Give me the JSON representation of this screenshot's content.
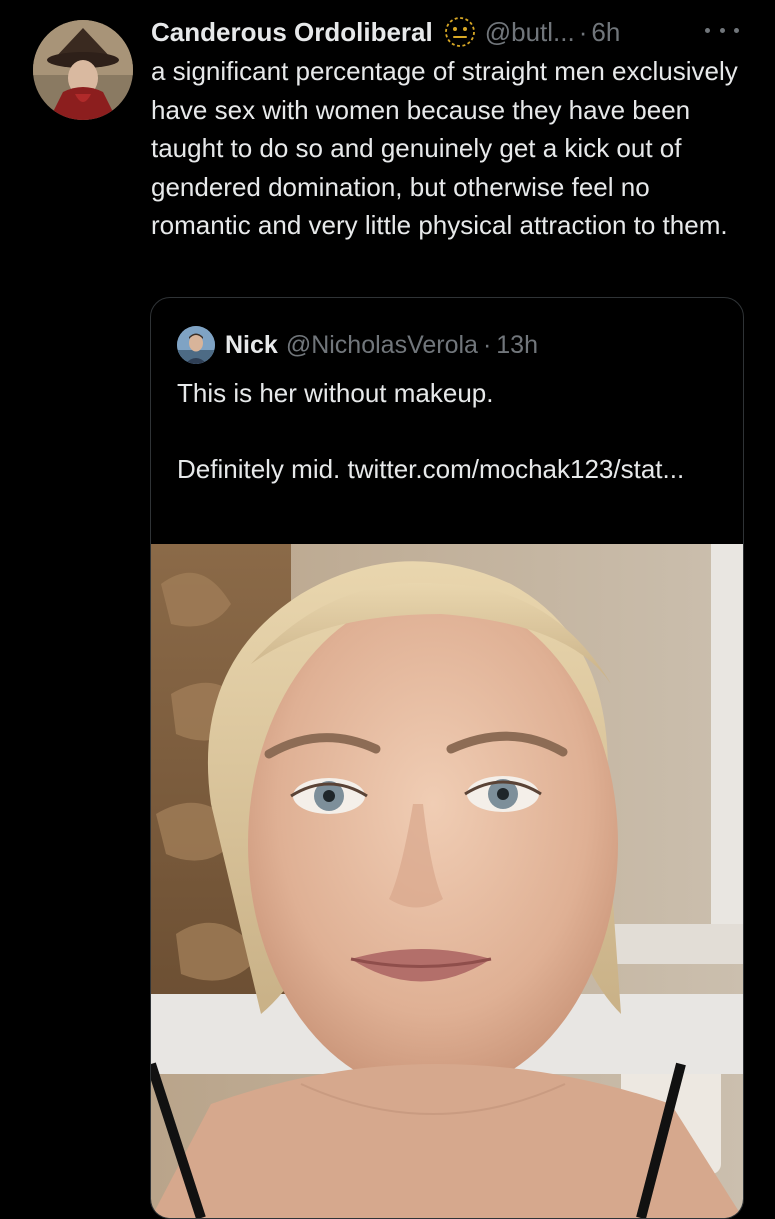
{
  "tweet": {
    "display_name": "Canderous Ordoliberal",
    "badge_icon": "neutral-face-emoji-icon",
    "handle": "@butl...",
    "separator": "·",
    "time": "6h",
    "more_icon": "more-horizontal-icon",
    "text": "a significant percentage of straight men exclusively have sex with women because they have been taught to do so and genuinely get a kick out of gendered domination, but otherwise feel no romantic and very little physical attraction to them."
  },
  "quote": {
    "display_name": "Nick",
    "handle": "@NicholasVerola",
    "separator": "·",
    "time": "13h",
    "text_line1": "This is her without makeup.",
    "text_line2": "Definitely mid. twitter.com/mochak123/stat..."
  },
  "colors": {
    "background": "#000000",
    "primary_text": "#e7e9ea",
    "secondary_text": "#71767b",
    "border": "#2f3336"
  }
}
